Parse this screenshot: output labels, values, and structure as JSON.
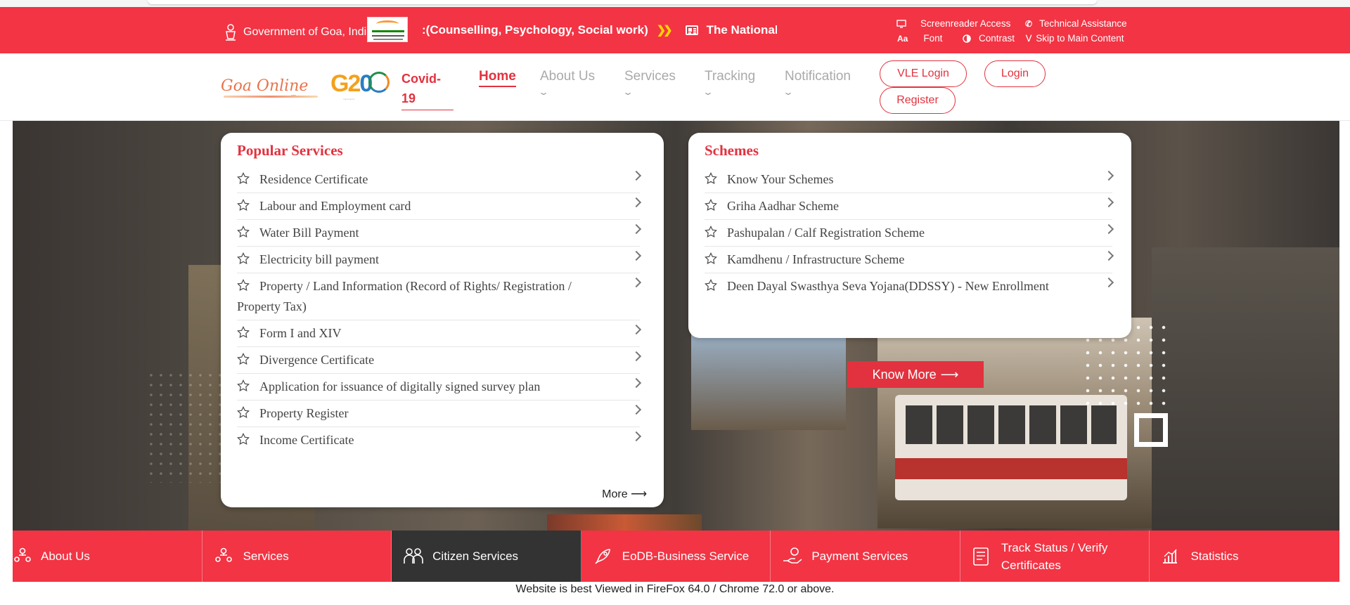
{
  "util_bar": {
    "gov_text": "Government of Goa, India",
    "marquee_segment_1": ":(Counselling, Psychology, Social work)",
    "marquee_segment_2": "The National",
    "screenreader": "Screenreader Access",
    "technical": "Technical Assistance",
    "font_icon": "Aa",
    "font": "Font",
    "contrast": "Contrast",
    "skip": "Skip to Main Content",
    "colors": {
      "background": "#f23444",
      "arrow": "#ffd400"
    },
    "icons": [
      "emblem-icon",
      "azadi-logo",
      "double-chevron-right-icon",
      "news-icon",
      "monitor-icon",
      "phone-icon",
      "contrast-icon",
      "chevron-double-down-icon"
    ]
  },
  "navbar": {
    "logo": "Goa Online",
    "g20_text": "G20",
    "g20_g": "G2",
    "g20_zero": "0",
    "covid": "Covid-19",
    "menu": [
      "Home",
      "About Us",
      "Services",
      "Tracking",
      "Notification"
    ],
    "vle_login": "VLE Login",
    "login": "Login",
    "register": "Register",
    "accent": "#e2323f"
  },
  "popular": {
    "title": "Popular Services",
    "items": [
      "Residence Certificate",
      "Labour and Employment card",
      "Water Bill Payment",
      "Electricity bill payment",
      "Property / Land Information (Record of Rights/ Registration / Property Tax)",
      "Form I and XIV",
      "Divergence Certificate",
      "Application for issuance of digitally signed survey plan",
      "Property Register",
      "Income Certificate"
    ],
    "more": "More"
  },
  "schemes": {
    "title": "Schemes",
    "items": [
      "Know Your Schemes",
      "Griha Aadhar Scheme",
      "Pashupalan / Calf Registration Scheme",
      "Kamdhenu / Infrastructure Scheme",
      "Deen Dayal Swasthya Seva Yojana(DDSSY) - New Enrollment"
    ]
  },
  "hero": {
    "know_more": "Know More"
  },
  "tabbar": {
    "items": [
      "About Us",
      "Services",
      "Citizen Services",
      "EoDB-Business Service",
      "Payment Services",
      "Track Status / Verify Certificates",
      "Statistics"
    ],
    "active_index": 2,
    "active_color": "#333333"
  },
  "footer": {
    "note": "Website is best Viewed in FireFox 64.0 / Chrome 72.0 or above."
  }
}
